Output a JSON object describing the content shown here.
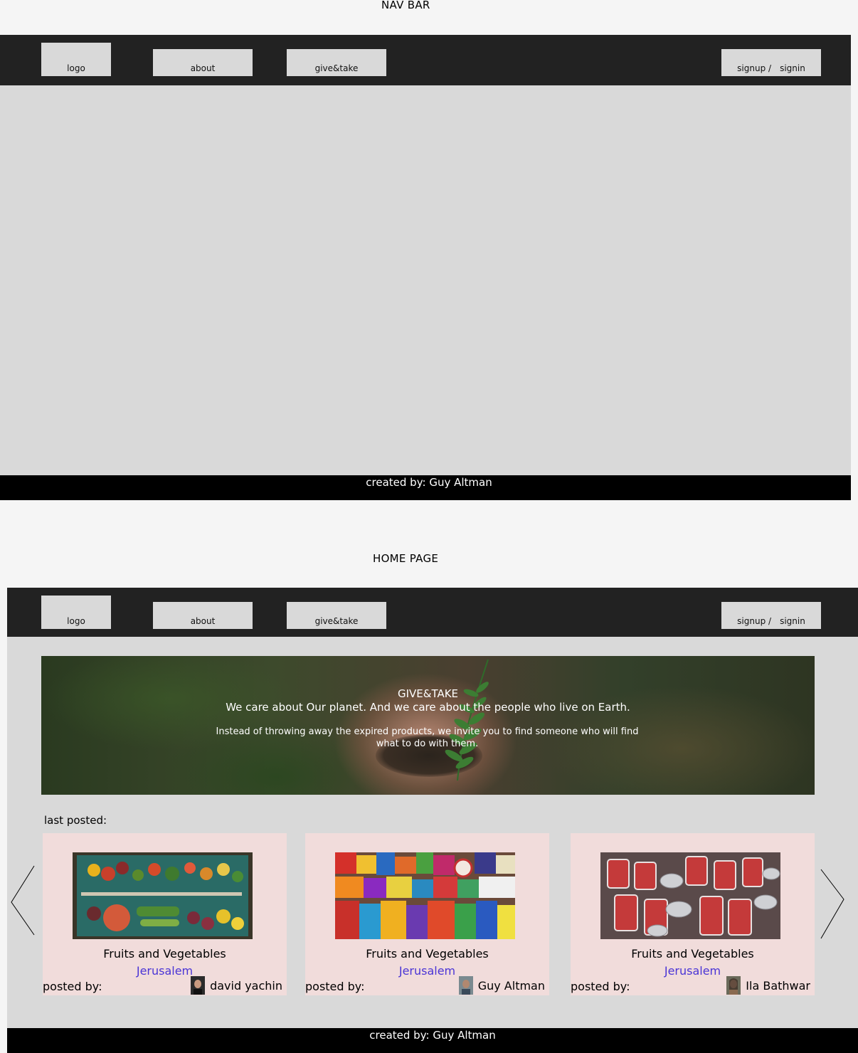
{
  "frames": {
    "navbar_label": "NAV BAR",
    "home_label": "HOME PAGE"
  },
  "nav": {
    "logo": "logo",
    "about": "about",
    "give_take": "give&take",
    "signup": "signup /",
    "signin": "signin"
  },
  "footer": {
    "text": "created by: Guy Altman"
  },
  "hero": {
    "title": "GIVE&TAKE",
    "tagline": "We care about Our planet. And we care about the people who live on Earth.",
    "body": "Instead of throwing away the expired products, we invite you to find someone who will find what to do with them."
  },
  "last_posted": {
    "label": "last posted:",
    "cards": [
      {
        "category": "Fruits and Vegetables",
        "city": "Jerusalem",
        "posted_by": "posted by:",
        "author": "david yachin"
      },
      {
        "category": "Fruits and Vegetables",
        "city": "Jerusalem",
        "posted_by": "posted by:",
        "author": "Guy Altman"
      },
      {
        "category": "Fruits and Vegetables",
        "city": "Jerusalem",
        "posted_by": "posted by:",
        "author": "Ila Bathwar"
      }
    ]
  },
  "colors": {
    "nav_bg": "#222222",
    "content_bg": "#d9d9d9",
    "card_bg": "#f1dcdb",
    "city_link": "#4a34d6",
    "footer_bg": "#000000"
  }
}
